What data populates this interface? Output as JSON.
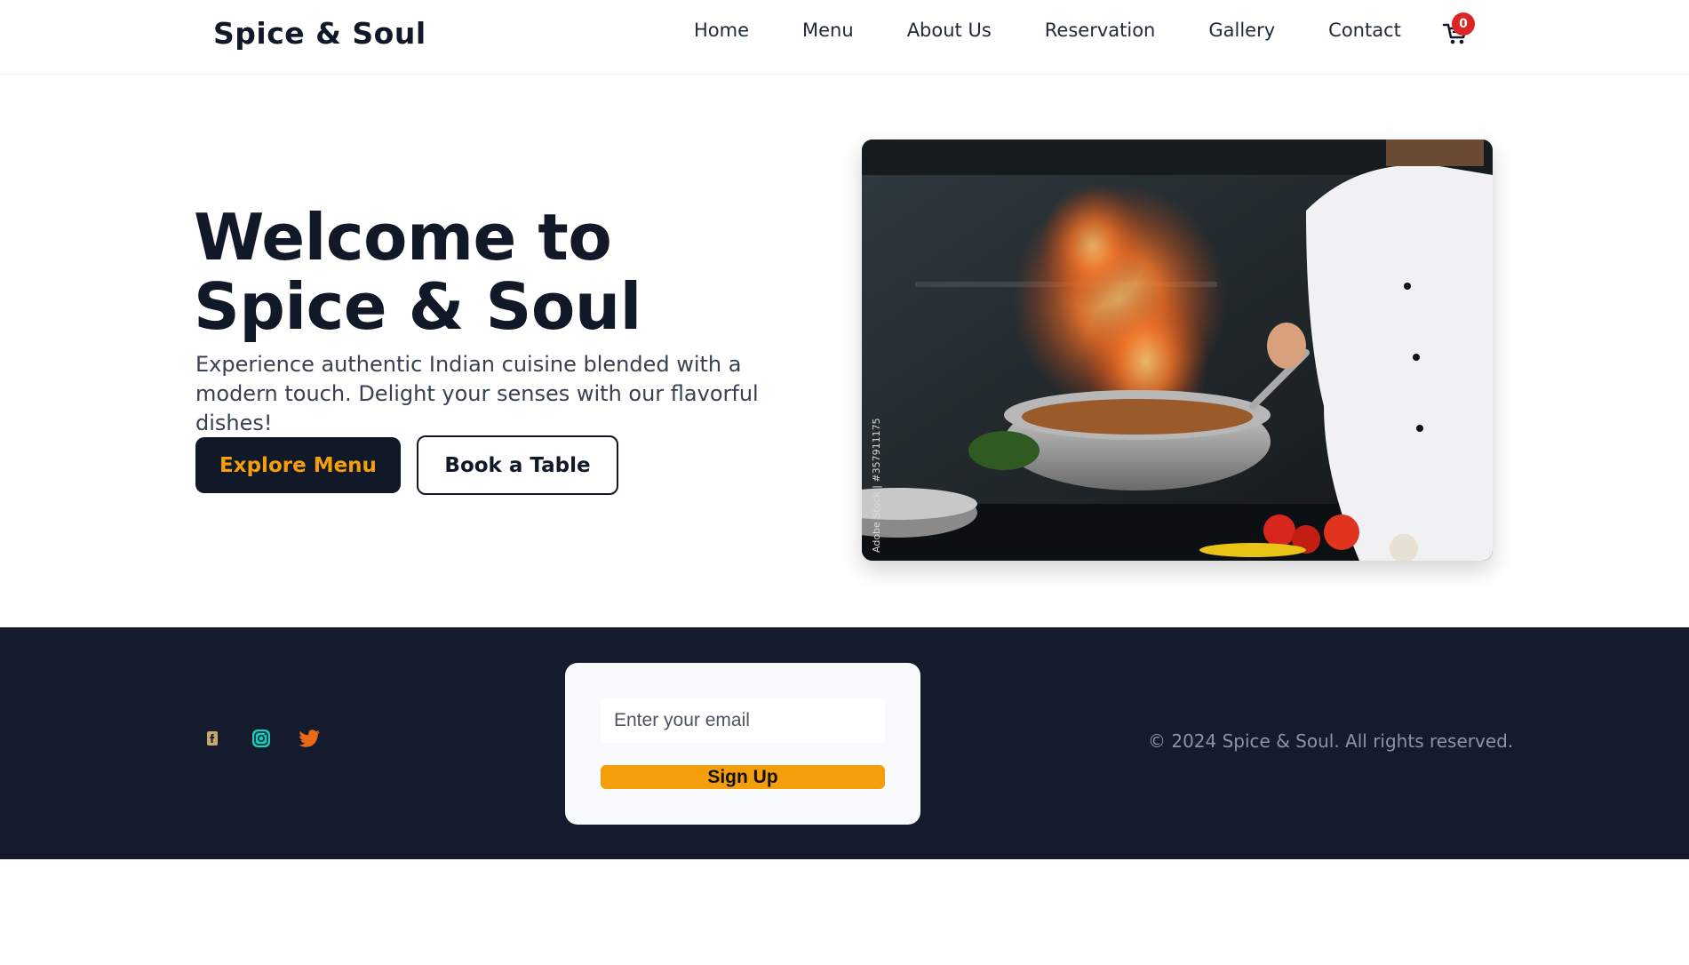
{
  "header": {
    "brand": "Spice & Soul",
    "nav": [
      "Home",
      "Menu",
      "About Us",
      "Reservation",
      "Gallery",
      "Contact"
    ],
    "cart_count": "0",
    "cart_icon": "cart-icon"
  },
  "hero": {
    "title": "Welcome to Spice & Soul",
    "subtitle": "Experience authentic Indian cuisine blended with a modern touch. Delight your senses with our flavorful dishes!",
    "primary_button": "Explore Menu",
    "secondary_button": "Book a Table",
    "image_watermark": "Adobe Stock | #357911175"
  },
  "footer": {
    "socials": [
      "facebook-icon",
      "instagram-icon",
      "twitter-icon"
    ],
    "email_placeholder": "Enter your email",
    "signup_label": "Sign Up",
    "copyright": "© 2024 Spice & Soul. All rights reserved."
  },
  "colors": {
    "dark": "#111827",
    "footer_bg": "#131b2c",
    "accent": "#f59e0b",
    "badge": "#dc2626"
  }
}
